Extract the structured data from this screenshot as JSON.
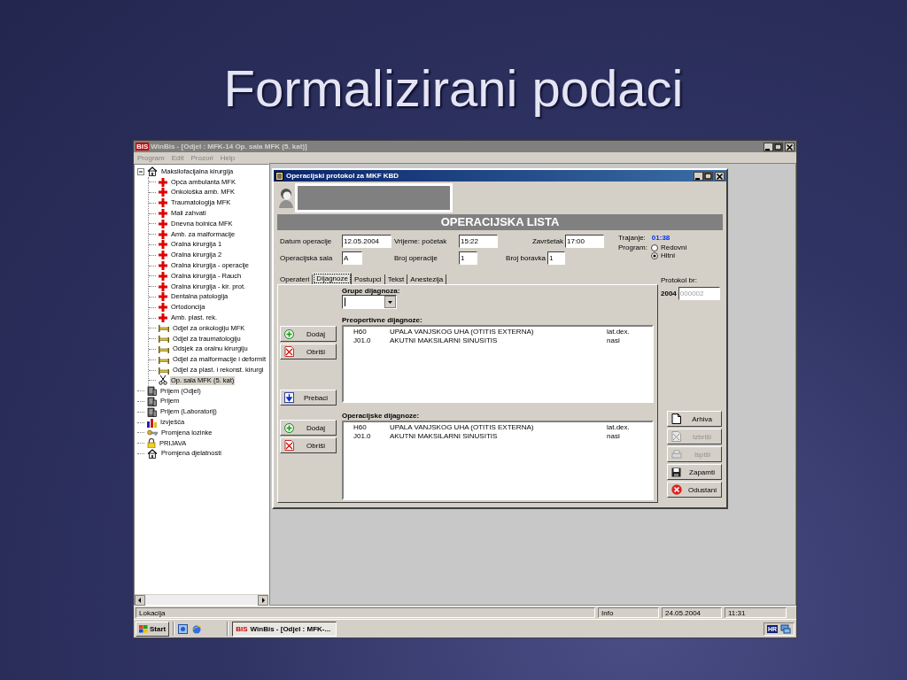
{
  "slide_title": "Formalizirani podaci",
  "app": {
    "logo": "BIS",
    "title": "WinBis - [Odjel : MFK-14 Op. sala MFK (5. kat)]",
    "menu": [
      "Program",
      "Edit",
      "Prozori",
      "Help"
    ]
  },
  "tree": {
    "items": [
      {
        "label": "Maksilofacijalna kirurgija",
        "kind": "house",
        "selected": false,
        "expanded": true,
        "children": [
          {
            "label": "Opća ambulanta MFK",
            "kind": "cross",
            "selected": false
          },
          {
            "label": "Onkološka amb. MFK",
            "kind": "cross",
            "selected": false
          },
          {
            "label": "Traumatologija MFK",
            "kind": "cross",
            "selected": false
          },
          {
            "label": "Mali zahvati",
            "kind": "cross",
            "selected": false
          },
          {
            "label": "Dnevna bolnica MFK",
            "kind": "cross",
            "selected": false
          },
          {
            "label": "Amb. za malformacije",
            "kind": "cross",
            "selected": false
          },
          {
            "label": "Oralna kirurgija 1",
            "kind": "cross",
            "selected": false
          },
          {
            "label": "Oralna kirurgija 2",
            "kind": "cross",
            "selected": false
          },
          {
            "label": "Oralna kirurgija - operacije",
            "kind": "cross",
            "selected": false
          },
          {
            "label": "Oralna kirurgija - Rauch",
            "kind": "cross",
            "selected": false
          },
          {
            "label": "Oralna kirurgija - kir. prot.",
            "kind": "cross",
            "selected": false
          },
          {
            "label": "Dentalna patologija",
            "kind": "cross",
            "selected": false
          },
          {
            "label": "Ortodoncija",
            "kind": "cross",
            "selected": false
          },
          {
            "label": "Amb. plast. rek.",
            "kind": "cross",
            "selected": false
          },
          {
            "label": "Odjel za onkologiju MFK",
            "kind": "bed",
            "selected": false
          },
          {
            "label": "Odjel za traumatologiju",
            "kind": "bed",
            "selected": false
          },
          {
            "label": "Odsjek za oralnu kirurgiju",
            "kind": "bed",
            "selected": false
          },
          {
            "label": "Odjel za malformacije i deformit",
            "kind": "bed",
            "selected": false
          },
          {
            "label": "Odjel za plast. i rekonst. kirurgi",
            "kind": "bed",
            "selected": false
          },
          {
            "label": "Op. sala MFK (5. kat)",
            "kind": "scissors",
            "selected": true
          }
        ]
      },
      {
        "label": "Prijem (Odjel)",
        "kind": "building",
        "selected": false
      },
      {
        "label": "Prijem",
        "kind": "building",
        "selected": false
      },
      {
        "label": "Prijem (Laboratorij)",
        "kind": "building",
        "selected": false
      },
      {
        "label": "Izvješća",
        "kind": "chart",
        "selected": false
      },
      {
        "label": "Promjena lozinke",
        "kind": "key",
        "selected": false
      },
      {
        "label": "PRIJAVA",
        "kind": "lock",
        "selected": false
      },
      {
        "label": "Promjena djelatnosti",
        "kind": "house",
        "selected": false
      }
    ]
  },
  "dialog": {
    "title": "Operacijski protokol za MKF KBD",
    "banner": "OPERACIJSKA LISTA",
    "fields": [
      [
        {
          "label": "Datum operacije",
          "value": "12.05.2004"
        },
        {
          "label": "Vrijeme: početak",
          "value": "15:22"
        },
        {
          "label": "Završetak",
          "value": "17:00"
        }
      ],
      [
        {
          "label": "Operacijska sala",
          "value": "A"
        },
        {
          "label": "Broj operacije",
          "value": "1"
        },
        {
          "label": "Broj boravka",
          "value": "1"
        }
      ]
    ],
    "duration": {
      "label": "Trajanje:",
      "value": "01:38"
    },
    "program": {
      "label": "Program:",
      "options": [
        {
          "label": "Redovni",
          "selected": false
        },
        {
          "label": "Hitni",
          "selected": true
        }
      ]
    },
    "tabs": [
      {
        "label": "Operateri",
        "selected": false
      },
      {
        "label": "Dijagnoze",
        "selected": true
      },
      {
        "label": "Postupci",
        "selected": false
      },
      {
        "label": "Tekst",
        "selected": false
      },
      {
        "label": "Anestezija",
        "selected": false
      }
    ],
    "groups_label": "Grupe dijagnoza:",
    "lists": [
      {
        "label": "Preopertivne dijagnoze:",
        "buttons": [
          {
            "label": "Dodaj",
            "kind": "add"
          },
          {
            "label": "Obriši",
            "kind": "delete"
          },
          {
            "label": "Prebaci",
            "kind": "move"
          }
        ],
        "rows": [
          {
            "code": "H60",
            "name": "UPALA VANJSKOG UHA (OTITIS EXTERNA)",
            "side": "lat.dex."
          },
          {
            "code": "J01.0",
            "name": "AKUTNI MAKSILARNI SINUSITIS",
            "side": "nasi"
          }
        ]
      },
      {
        "label": "Operacijske dijagnoze:",
        "buttons": [
          {
            "label": "Dodaj",
            "kind": "add"
          },
          {
            "label": "Obriši",
            "kind": "delete"
          }
        ],
        "rows": [
          {
            "code": "H60",
            "name": "UPALA VANJSKOG UHA (OTITIS EXTERNA)",
            "side": "lat.dex."
          },
          {
            "code": "J01.0",
            "name": "AKUTNI MAKSILARNI SINUSITIS",
            "side": "nasi"
          }
        ]
      }
    ],
    "protocol": {
      "label": "Protokol br:",
      "year": "2004",
      "number": "000002"
    },
    "actions": [
      {
        "label": "Arhiva",
        "kind": "archive",
        "disabled": false
      },
      {
        "label": "Izbriši",
        "kind": "erase",
        "disabled": true
      },
      {
        "label": "Ispiši",
        "kind": "print",
        "disabled": true
      },
      {
        "label": "Zapamti",
        "kind": "save",
        "disabled": false
      },
      {
        "label": "Odustani",
        "kind": "cancel",
        "disabled": false
      }
    ]
  },
  "status_bar": [
    {
      "text": "Lokacija"
    },
    {
      "text": "Info"
    },
    {
      "text": "24.05.2004"
    },
    {
      "text": "11:31"
    }
  ],
  "taskbar": {
    "start": "Start",
    "tasks": [
      {
        "logo": "BIS",
        "label": "WinBis - [Odjel : MFK-..."
      }
    ],
    "language": "HR"
  }
}
